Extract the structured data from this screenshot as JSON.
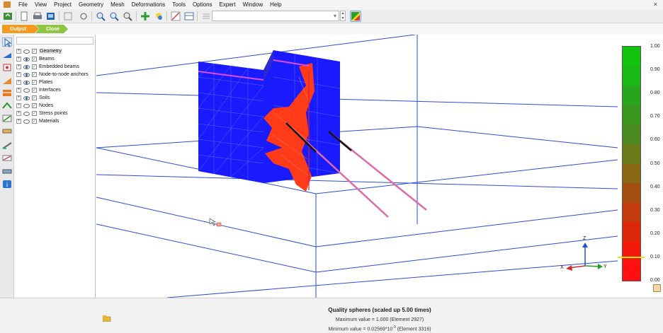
{
  "menu": [
    "File",
    "View",
    "Project",
    "Geometry",
    "Mesh",
    "Deformations",
    "Tools",
    "Options",
    "Expert",
    "Window",
    "Help"
  ],
  "window_close_glyph": "×",
  "toolbar": {
    "icons": [
      "update-icon",
      "new-icon",
      "print-icon",
      "export-icon",
      "zoom-window-icon",
      "zoom-in-icon",
      "zoom-out-icon",
      "pan-icon",
      "rotate-icon",
      "scale-icon",
      "table-icon",
      "curves-icon",
      "color-legend-icon"
    ],
    "step_combo_value": ""
  },
  "nav": {
    "output_label": "Output",
    "close_label": "Close"
  },
  "sidebar_tools": [
    "select-icon",
    "deformed-mesh-icon",
    "point-icon",
    "structure-icon",
    "cross-section-icon",
    "section-icon",
    "line-icon",
    "plates-icon",
    "beams-icon",
    "anchors-icon",
    "interfaces-icon",
    "info-icon"
  ],
  "tree": {
    "filter_value": "",
    "items": [
      {
        "label": "Geometry",
        "eye": false,
        "checked": true,
        "selected": true
      },
      {
        "label": "Beams",
        "eye": true,
        "checked": true
      },
      {
        "label": "Embedded beams",
        "eye": true,
        "checked": true
      },
      {
        "label": "Node-to-node anchors",
        "eye": true,
        "checked": true
      },
      {
        "label": "Plates",
        "eye": true,
        "checked": true
      },
      {
        "label": "Interfaces",
        "eye": false,
        "checked": true
      },
      {
        "label": "Soils",
        "eye": true,
        "checked": true
      },
      {
        "label": "Nodes",
        "eye": false,
        "checked": true
      },
      {
        "label": "Stress points",
        "eye": false,
        "checked": true
      },
      {
        "label": "Materials",
        "eye": false,
        "checked": true
      }
    ]
  },
  "legend": {
    "ticks": [
      "1.00",
      "0.90",
      "0.80",
      "0.70",
      "0.60",
      "0.50",
      "0.40",
      "0.30",
      "0.20",
      "0.10",
      "0.00"
    ],
    "marker_value": 0.1,
    "colors": [
      "#11c20e",
      "#1ab814",
      "#27a51b",
      "#3a951e",
      "#4b8a1e",
      "#6a7c19",
      "#8a6915",
      "#a44e12",
      "#c23a0e",
      "#dc270b",
      "#f4180a",
      "#ff0f0f"
    ]
  },
  "axes_labels": {
    "z": "Z",
    "x": "X",
    "y": "Y"
  },
  "status": {
    "title": "Quality spheres (scaled up 5.00 times)",
    "max": "Maximum value = 1.000  (Element 2927)",
    "min_prefix": "Minimum value = 0.02569*10",
    "min_exp": "-3",
    "min_suffix": "  (Element 3316)"
  },
  "colors": {
    "mesh_blue": "#1a1aff",
    "quality_red": "#ff3b1a",
    "anchor_pink": "#e06aa8",
    "grid_line": "#2a4dd6"
  }
}
